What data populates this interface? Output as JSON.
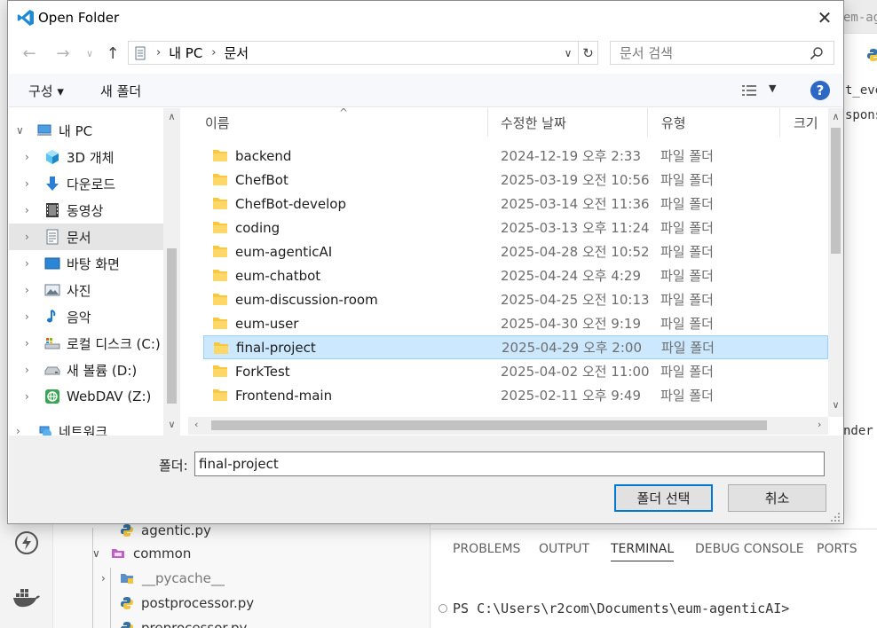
{
  "dialog": {
    "title": "Open Folder",
    "close_label": "✕"
  },
  "address": {
    "crumbs": [
      "내 PC",
      "문서"
    ]
  },
  "search": {
    "placeholder": "문서 검색"
  },
  "toolbar": {
    "organize_label": "구성 ▾",
    "new_folder_label": "새 폴더",
    "help_label": "?"
  },
  "nav": {
    "items": [
      {
        "label": "내 PC",
        "icon": "pc-icon"
      },
      {
        "label": "3D 개체",
        "icon": "3d-objects-icon"
      },
      {
        "label": "다운로드",
        "icon": "download-icon"
      },
      {
        "label": "동영상",
        "icon": "video-icon"
      },
      {
        "label": "문서",
        "icon": "document-icon"
      },
      {
        "label": "바탕 화면",
        "icon": "desktop-icon"
      },
      {
        "label": "사진",
        "icon": "pictures-icon"
      },
      {
        "label": "음악",
        "icon": "music-icon"
      },
      {
        "label": "로컬 디스크 (C:)",
        "icon": "local-disk-icon"
      },
      {
        "label": "새 볼륨 (D:)",
        "icon": "drive-icon"
      },
      {
        "label": "WebDAV (Z:)",
        "icon": "network-drive-icon"
      },
      {
        "label": "네트워크",
        "icon": "network-icon"
      }
    ]
  },
  "files": {
    "columns": [
      "이름",
      "수정한 날짜",
      "유형",
      "크기"
    ],
    "rows": [
      {
        "name": "backend",
        "date": "2024-12-19 오후 2:33",
        "type": "파일 폴더"
      },
      {
        "name": "ChefBot",
        "date": "2025-03-19 오전 10:56",
        "type": "파일 폴더"
      },
      {
        "name": "ChefBot-develop",
        "date": "2025-03-14 오전 11:36",
        "type": "파일 폴더"
      },
      {
        "name": "coding",
        "date": "2025-03-13 오후 11:24",
        "type": "파일 폴더"
      },
      {
        "name": "eum-agenticAI",
        "date": "2025-04-28 오전 10:52",
        "type": "파일 폴더"
      },
      {
        "name": "eum-chatbot",
        "date": "2025-04-24 오후 4:29",
        "type": "파일 폴더"
      },
      {
        "name": "eum-discussion-room",
        "date": "2025-04-25 오전 10:13",
        "type": "파일 폴더"
      },
      {
        "name": "eum-user",
        "date": "2025-04-30 오전 9:19",
        "type": "파일 폴더"
      },
      {
        "name": "final-project",
        "date": "2025-04-29 오후 2:00",
        "type": "파일 폴더"
      },
      {
        "name": "ForkTest",
        "date": "2025-04-02 오전 11:00",
        "type": "파일 폴더"
      },
      {
        "name": "Frontend-main",
        "date": "2025-02-11 오후 9:49",
        "type": "파일 폴더"
      }
    ]
  },
  "bottom": {
    "folder_label": "폴더:",
    "folder_value": "final-project",
    "select_label": "폴더 선택",
    "cancel_label": "취소"
  },
  "vscode": {
    "explorer": [
      {
        "label": "agentic.py",
        "kind": "py"
      },
      {
        "label": "common",
        "kind": "folder"
      },
      {
        "label": "__pycache__",
        "kind": "pyfolder"
      },
      {
        "label": "postprocessor.py",
        "kind": "py"
      },
      {
        "label": "preprocessor.py",
        "kind": "py"
      }
    ],
    "editor_fragments": [
      "em-agen",
      "t_even",
      "sponse",
      "nder"
    ],
    "panel_tabs": [
      "PROBLEMS",
      "OUTPUT",
      "TERMINAL",
      "DEBUG CONSOLE",
      "PORTS"
    ],
    "terminal_prompt": "PS C:\\Users\\r2com\\Documents\\eum-agenticAI>"
  },
  "colors": {
    "accent": "#0078d4",
    "selection": "#cce8ff",
    "folder": "#f8c842"
  }
}
